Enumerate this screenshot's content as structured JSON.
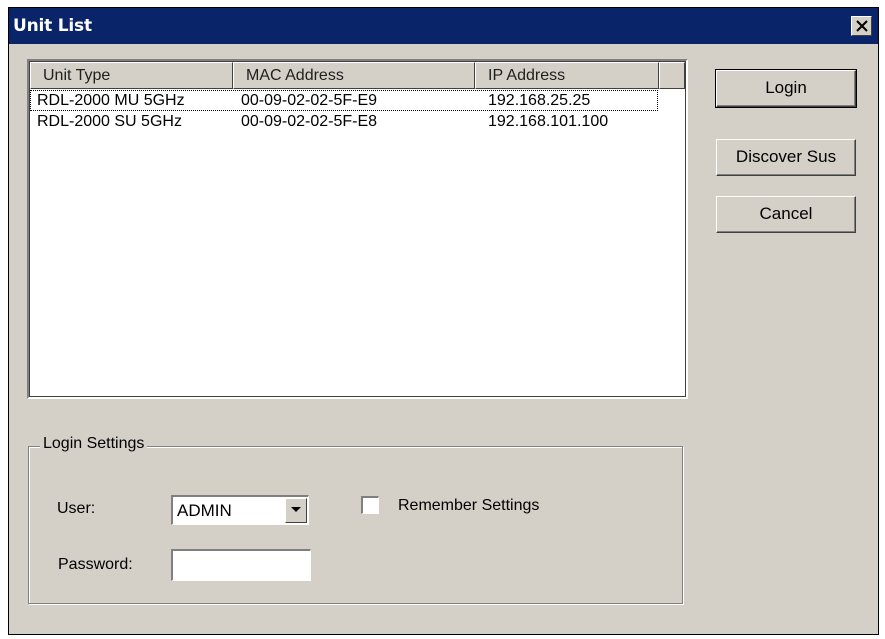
{
  "window": {
    "title": "Unit List",
    "close_glyph": "✕"
  },
  "unit_list": {
    "columns": [
      "Unit Type",
      "MAC Address",
      "IP Address"
    ],
    "rows": [
      {
        "unit_type": "RDL-2000 MU 5GHz",
        "mac": "00-09-02-02-5F-E9",
        "ip": "192.168.25.25"
      },
      {
        "unit_type": "RDL-2000 SU 5GHz",
        "mac": "00-09-02-02-5F-E8",
        "ip": "192.168.101.100"
      }
    ]
  },
  "buttons": {
    "login": "Login",
    "discover": "Discover Sus",
    "cancel": "Cancel"
  },
  "login_settings": {
    "legend": "Login Settings",
    "user_label": "User:",
    "user_value": "ADMIN",
    "remember_label": "Remember Settings",
    "remember_checked": false,
    "password_label": "Password:",
    "password_value": ""
  },
  "colors": {
    "titlebar": "#0a246a",
    "dialog_face": "#d4d0c8"
  },
  "icons": {
    "close": "close-icon",
    "dropdown": "chevron-down-icon"
  }
}
